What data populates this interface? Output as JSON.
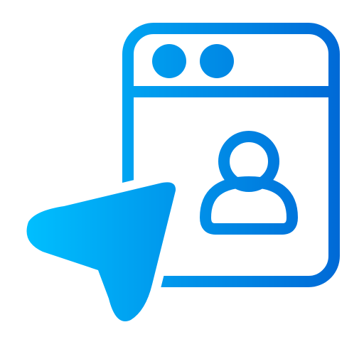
{
  "icon": {
    "name": "web-profile-click-icon",
    "gradient": {
      "start": "#00C0FF",
      "end": "#0069D6"
    },
    "background": "#FFFFFF"
  }
}
